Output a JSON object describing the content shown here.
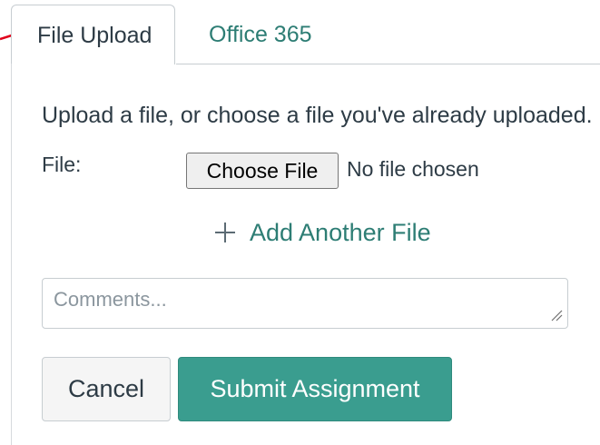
{
  "annotation": {
    "arrow_icon": "red-arrow-icon",
    "arrow_color": "#e0001b"
  },
  "tabs": [
    {
      "label": "File Upload",
      "active": true
    },
    {
      "label": "Office 365",
      "active": false
    }
  ],
  "upload": {
    "intro_text": "Upload a file, or choose a file you've already uploaded.",
    "file_label": "File:",
    "choose_button_label": "Choose File",
    "no_file_text": "No file chosen",
    "add_another_icon": "plus-icon",
    "add_another_label": "Add Another File"
  },
  "comments": {
    "placeholder": "Comments...",
    "value": ""
  },
  "actions": {
    "cancel_label": "Cancel",
    "submit_label": "Submit Assignment"
  },
  "colors": {
    "accent": "#2d7d74",
    "submit_bg": "#3a9d8f",
    "text": "#2d3b45",
    "border": "#c7cdd1"
  }
}
